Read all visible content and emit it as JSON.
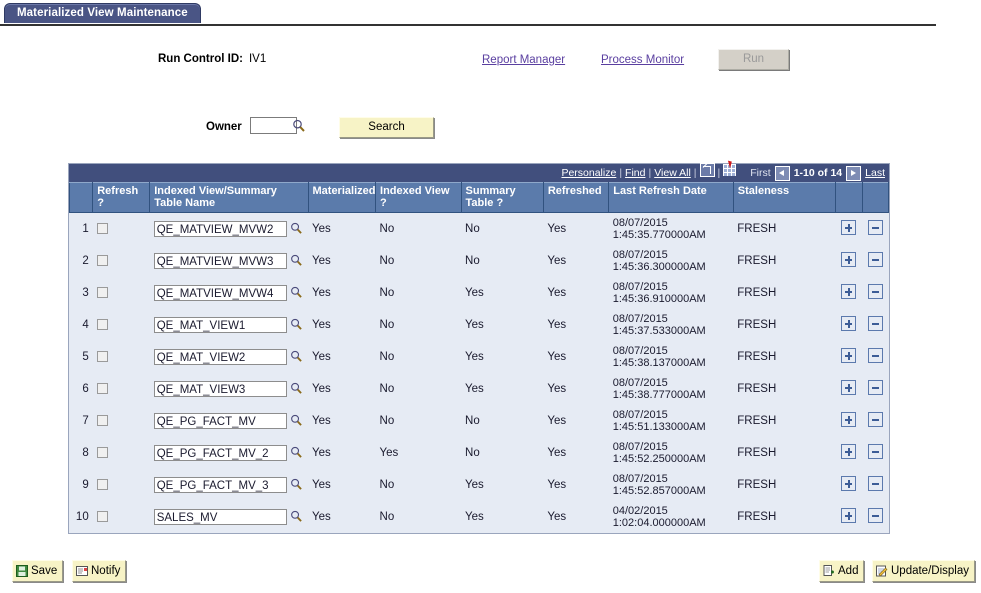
{
  "tab": {
    "label": "Materialized View Maintenance"
  },
  "header": {
    "run_control_label": "Run Control ID:",
    "run_control_value": "IV1",
    "report_manager_link": "Report Manager",
    "process_monitor_link": "Process Monitor",
    "run_button": "Run"
  },
  "search_area": {
    "owner_label": "Owner",
    "owner_value": "",
    "owner_placeholder": "",
    "lookup_icon": "magnifier-icon",
    "search_button": "Search"
  },
  "grid_toolbar": {
    "personalize": "Personalize",
    "find": "Find",
    "view_all": "View All",
    "sep": "|",
    "expand_icon": "expand-window-icon",
    "download_icon": "download-to-spreadsheet-icon",
    "first": "First",
    "prev_icon": "previous-page-arrow-icon",
    "range": "1-10 of 14",
    "next_icon": "next-page-arrow-icon",
    "last": "Last"
  },
  "grid": {
    "columns": [
      "",
      "Refresh ?",
      "Indexed View/Summary Table Name",
      "Materialized",
      "Indexed View ?",
      "Summary Table ?",
      "Refreshed",
      "Last Refresh Date",
      "Staleness",
      "",
      ""
    ],
    "rows": [
      {
        "num": "1",
        "refresh_checked": false,
        "name": "QE_MATVIEW_MVW2",
        "materialized": "Yes",
        "indexed_view": "No",
        "summary_table": "No",
        "refreshed": "Yes",
        "date": "08/07/2015",
        "time": "1:45:35.770000AM",
        "staleness": "FRESH",
        "add_row": "+",
        "delete_row": "-"
      },
      {
        "num": "2",
        "refresh_checked": false,
        "name": "QE_MATVIEW_MVW3",
        "materialized": "Yes",
        "indexed_view": "No",
        "summary_table": "No",
        "refreshed": "Yes",
        "date": "08/07/2015",
        "time": "1:45:36.300000AM",
        "staleness": "FRESH",
        "add_row": "+",
        "delete_row": "-"
      },
      {
        "num": "3",
        "refresh_checked": false,
        "name": "QE_MATVIEW_MVW4",
        "materialized": "Yes",
        "indexed_view": "No",
        "summary_table": "Yes",
        "refreshed": "Yes",
        "date": "08/07/2015",
        "time": "1:45:36.910000AM",
        "staleness": "FRESH",
        "add_row": "+",
        "delete_row": "-"
      },
      {
        "num": "4",
        "refresh_checked": false,
        "name": "QE_MAT_VIEW1",
        "materialized": "Yes",
        "indexed_view": "No",
        "summary_table": "Yes",
        "refreshed": "Yes",
        "date": "08/07/2015",
        "time": "1:45:37.533000AM",
        "staleness": "FRESH",
        "add_row": "+",
        "delete_row": "-"
      },
      {
        "num": "5",
        "refresh_checked": false,
        "name": "QE_MAT_VIEW2",
        "materialized": "Yes",
        "indexed_view": "No",
        "summary_table": "Yes",
        "refreshed": "Yes",
        "date": "08/07/2015",
        "time": "1:45:38.137000AM",
        "staleness": "FRESH",
        "add_row": "+",
        "delete_row": "-"
      },
      {
        "num": "6",
        "refresh_checked": false,
        "name": "QE_MAT_VIEW3",
        "materialized": "Yes",
        "indexed_view": "No",
        "summary_table": "Yes",
        "refreshed": "Yes",
        "date": "08/07/2015",
        "time": "1:45:38.777000AM",
        "staleness": "FRESH",
        "add_row": "+",
        "delete_row": "-"
      },
      {
        "num": "7",
        "refresh_checked": false,
        "name": "QE_PG_FACT_MV",
        "materialized": "Yes",
        "indexed_view": "No",
        "summary_table": "No",
        "refreshed": "Yes",
        "date": "08/07/2015",
        "time": "1:45:51.133000AM",
        "staleness": "FRESH",
        "add_row": "+",
        "delete_row": "-"
      },
      {
        "num": "8",
        "refresh_checked": false,
        "name": "QE_PG_FACT_MV_2",
        "materialized": "Yes",
        "indexed_view": "Yes",
        "summary_table": "No",
        "refreshed": "Yes",
        "date": "08/07/2015",
        "time": "1:45:52.250000AM",
        "staleness": "FRESH",
        "add_row": "+",
        "delete_row": "-"
      },
      {
        "num": "9",
        "refresh_checked": false,
        "name": "QE_PG_FACT_MV_3",
        "materialized": "Yes",
        "indexed_view": "No",
        "summary_table": "Yes",
        "refreshed": "Yes",
        "date": "08/07/2015",
        "time": "1:45:52.857000AM",
        "staleness": "FRESH",
        "add_row": "+",
        "delete_row": "-"
      },
      {
        "num": "10",
        "refresh_checked": false,
        "name": "SALES_MV",
        "materialized": "Yes",
        "indexed_view": "No",
        "summary_table": "Yes",
        "refreshed": "Yes",
        "date": "04/02/2015",
        "time": "1:02:04.000000AM",
        "staleness": "FRESH",
        "add_row": "+",
        "delete_row": "-"
      }
    ]
  },
  "footer": {
    "save": "Save",
    "notify": "Notify",
    "add": "Add",
    "update_display": "Update/Display"
  },
  "colors": {
    "tab_bg": "#4a5585",
    "toolbar_bg": "#414f7d",
    "header_bg": "#5b7bab",
    "row_bg": "#e6ebf4",
    "link": "#5a3fa0",
    "button_yellow": "#f7f3c6"
  }
}
